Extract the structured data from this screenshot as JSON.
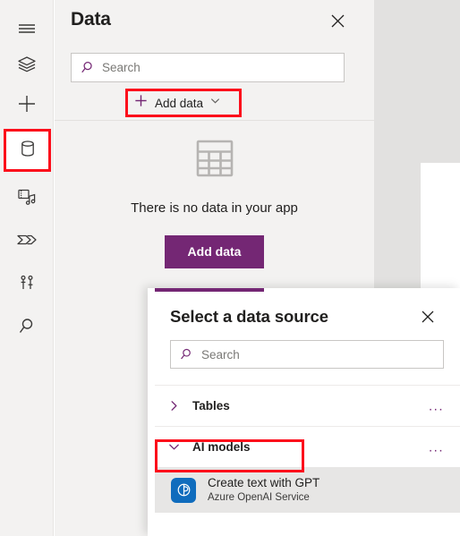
{
  "colors": {
    "accent_purple": "#742774",
    "highlight_red": "#fc0d1b",
    "panel_bg": "#f3f2f1",
    "canvas_bg": "#e2e1e0",
    "azure_blue": "#0f6cbd"
  },
  "rail": {
    "items": [
      {
        "name": "menu-icon",
        "label": "Menu"
      },
      {
        "name": "tree-view-icon",
        "label": "Tree view"
      },
      {
        "name": "insert-icon",
        "label": "Insert"
      },
      {
        "name": "data-icon",
        "label": "Data"
      },
      {
        "name": "media-icon",
        "label": "Media"
      },
      {
        "name": "power-automate-icon",
        "label": "Power Automate"
      },
      {
        "name": "variables-icon",
        "label": "Variables"
      },
      {
        "name": "search-icon",
        "label": "Search"
      }
    ],
    "selected": "data-icon"
  },
  "data_panel": {
    "title": "Data",
    "close_label": "Close",
    "search": {
      "placeholder": "Search",
      "value": ""
    },
    "add_data_menu": {
      "label": "Add data",
      "plus_icon": "plus-icon",
      "chevron_icon": "chevron-down-icon",
      "highlighted": true
    },
    "empty_state": {
      "icon": "table-icon",
      "message": "There is no data in your app",
      "button_label": "Add data"
    }
  },
  "dialog": {
    "title": "Select a data source",
    "close_label": "Close",
    "search": {
      "placeholder": "Search",
      "value": ""
    },
    "groups": [
      {
        "label": "Tables",
        "expanded": false,
        "chevron_icon": "chevron-right-icon",
        "overflow_label": "...",
        "highlighted": false,
        "items": []
      },
      {
        "label": "AI models",
        "expanded": true,
        "chevron_icon": "chevron-down-icon",
        "overflow_label": "...",
        "highlighted": true,
        "items": [
          {
            "title": "Create text with GPT",
            "subtitle": "Azure OpenAI Service",
            "icon": "azure-openai-icon"
          }
        ]
      }
    ]
  }
}
